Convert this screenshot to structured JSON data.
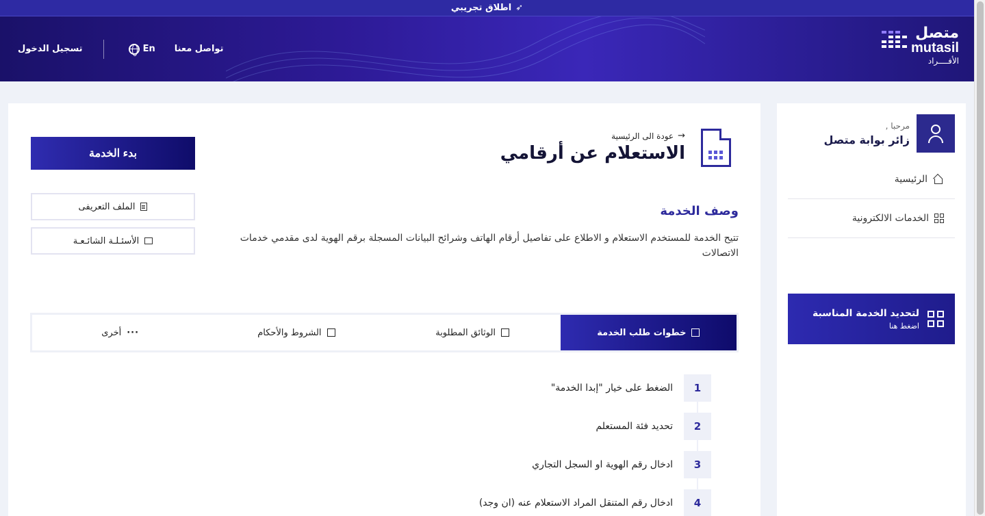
{
  "banner": {
    "text": "اطلاق تجريبي",
    "icon": "rocket-icon"
  },
  "header": {
    "logo_ar": "متصل",
    "logo_en": "mutasil",
    "logo_sub": "الأفــــراد",
    "contact": "تواصل معنا",
    "lang": "En",
    "login": "تسجيل الدخول"
  },
  "sidebar": {
    "greeting": "مرحبا ,",
    "user_name": "زائر بوابة متصل",
    "items": [
      {
        "label": "الرئيسية",
        "icon": "home-icon"
      },
      {
        "label": "الخدمات الالكترونية",
        "icon": "grid-icon"
      }
    ],
    "promo": {
      "title": "لتحديد الخدمة المناسبة",
      "subtitle": "اضغط هنا",
      "icon": "qr-icon"
    }
  },
  "main": {
    "back_label": "عودة الى الرئيسية",
    "title": "الاستعلام عن أرقامي",
    "desc_heading": "وصف الخدمة",
    "description": "تتيح الخدمة للمستخدم الاستعلام و الاطلاع على تفاصيل أرقام الهاتف وشرائح البيانات المسجلة برقم الهوية لدى مقدمي خدمات الاتصالات",
    "start_button": "بدء الخدمة",
    "profile_button": "الملف التعريفى",
    "faq_button": "الأسئـلـة الشائـعـة",
    "tabs": [
      {
        "label": "خطوات طلب الخدمة",
        "active": true
      },
      {
        "label": "الوثائق المطلوبة",
        "active": false
      },
      {
        "label": "الشروط والأحكام",
        "active": false
      },
      {
        "label": "أخرى",
        "active": false
      }
    ],
    "steps": [
      {
        "num": "1",
        "text": "الضغط على خيار \"إبدا الخدمة\""
      },
      {
        "num": "2",
        "text": "تحديد فئة المستعلم"
      },
      {
        "num": "3",
        "text": "ادخال رقم الهوية او السجل التجاري"
      },
      {
        "num": "4",
        "text": "ادخال رقم المتنقل المراد الاستعلام عنه (ان وجد)"
      }
    ]
  },
  "colors": {
    "primary": "#2d2a9c",
    "header_dark": "#1a1169",
    "bg": "#eff2f8"
  }
}
